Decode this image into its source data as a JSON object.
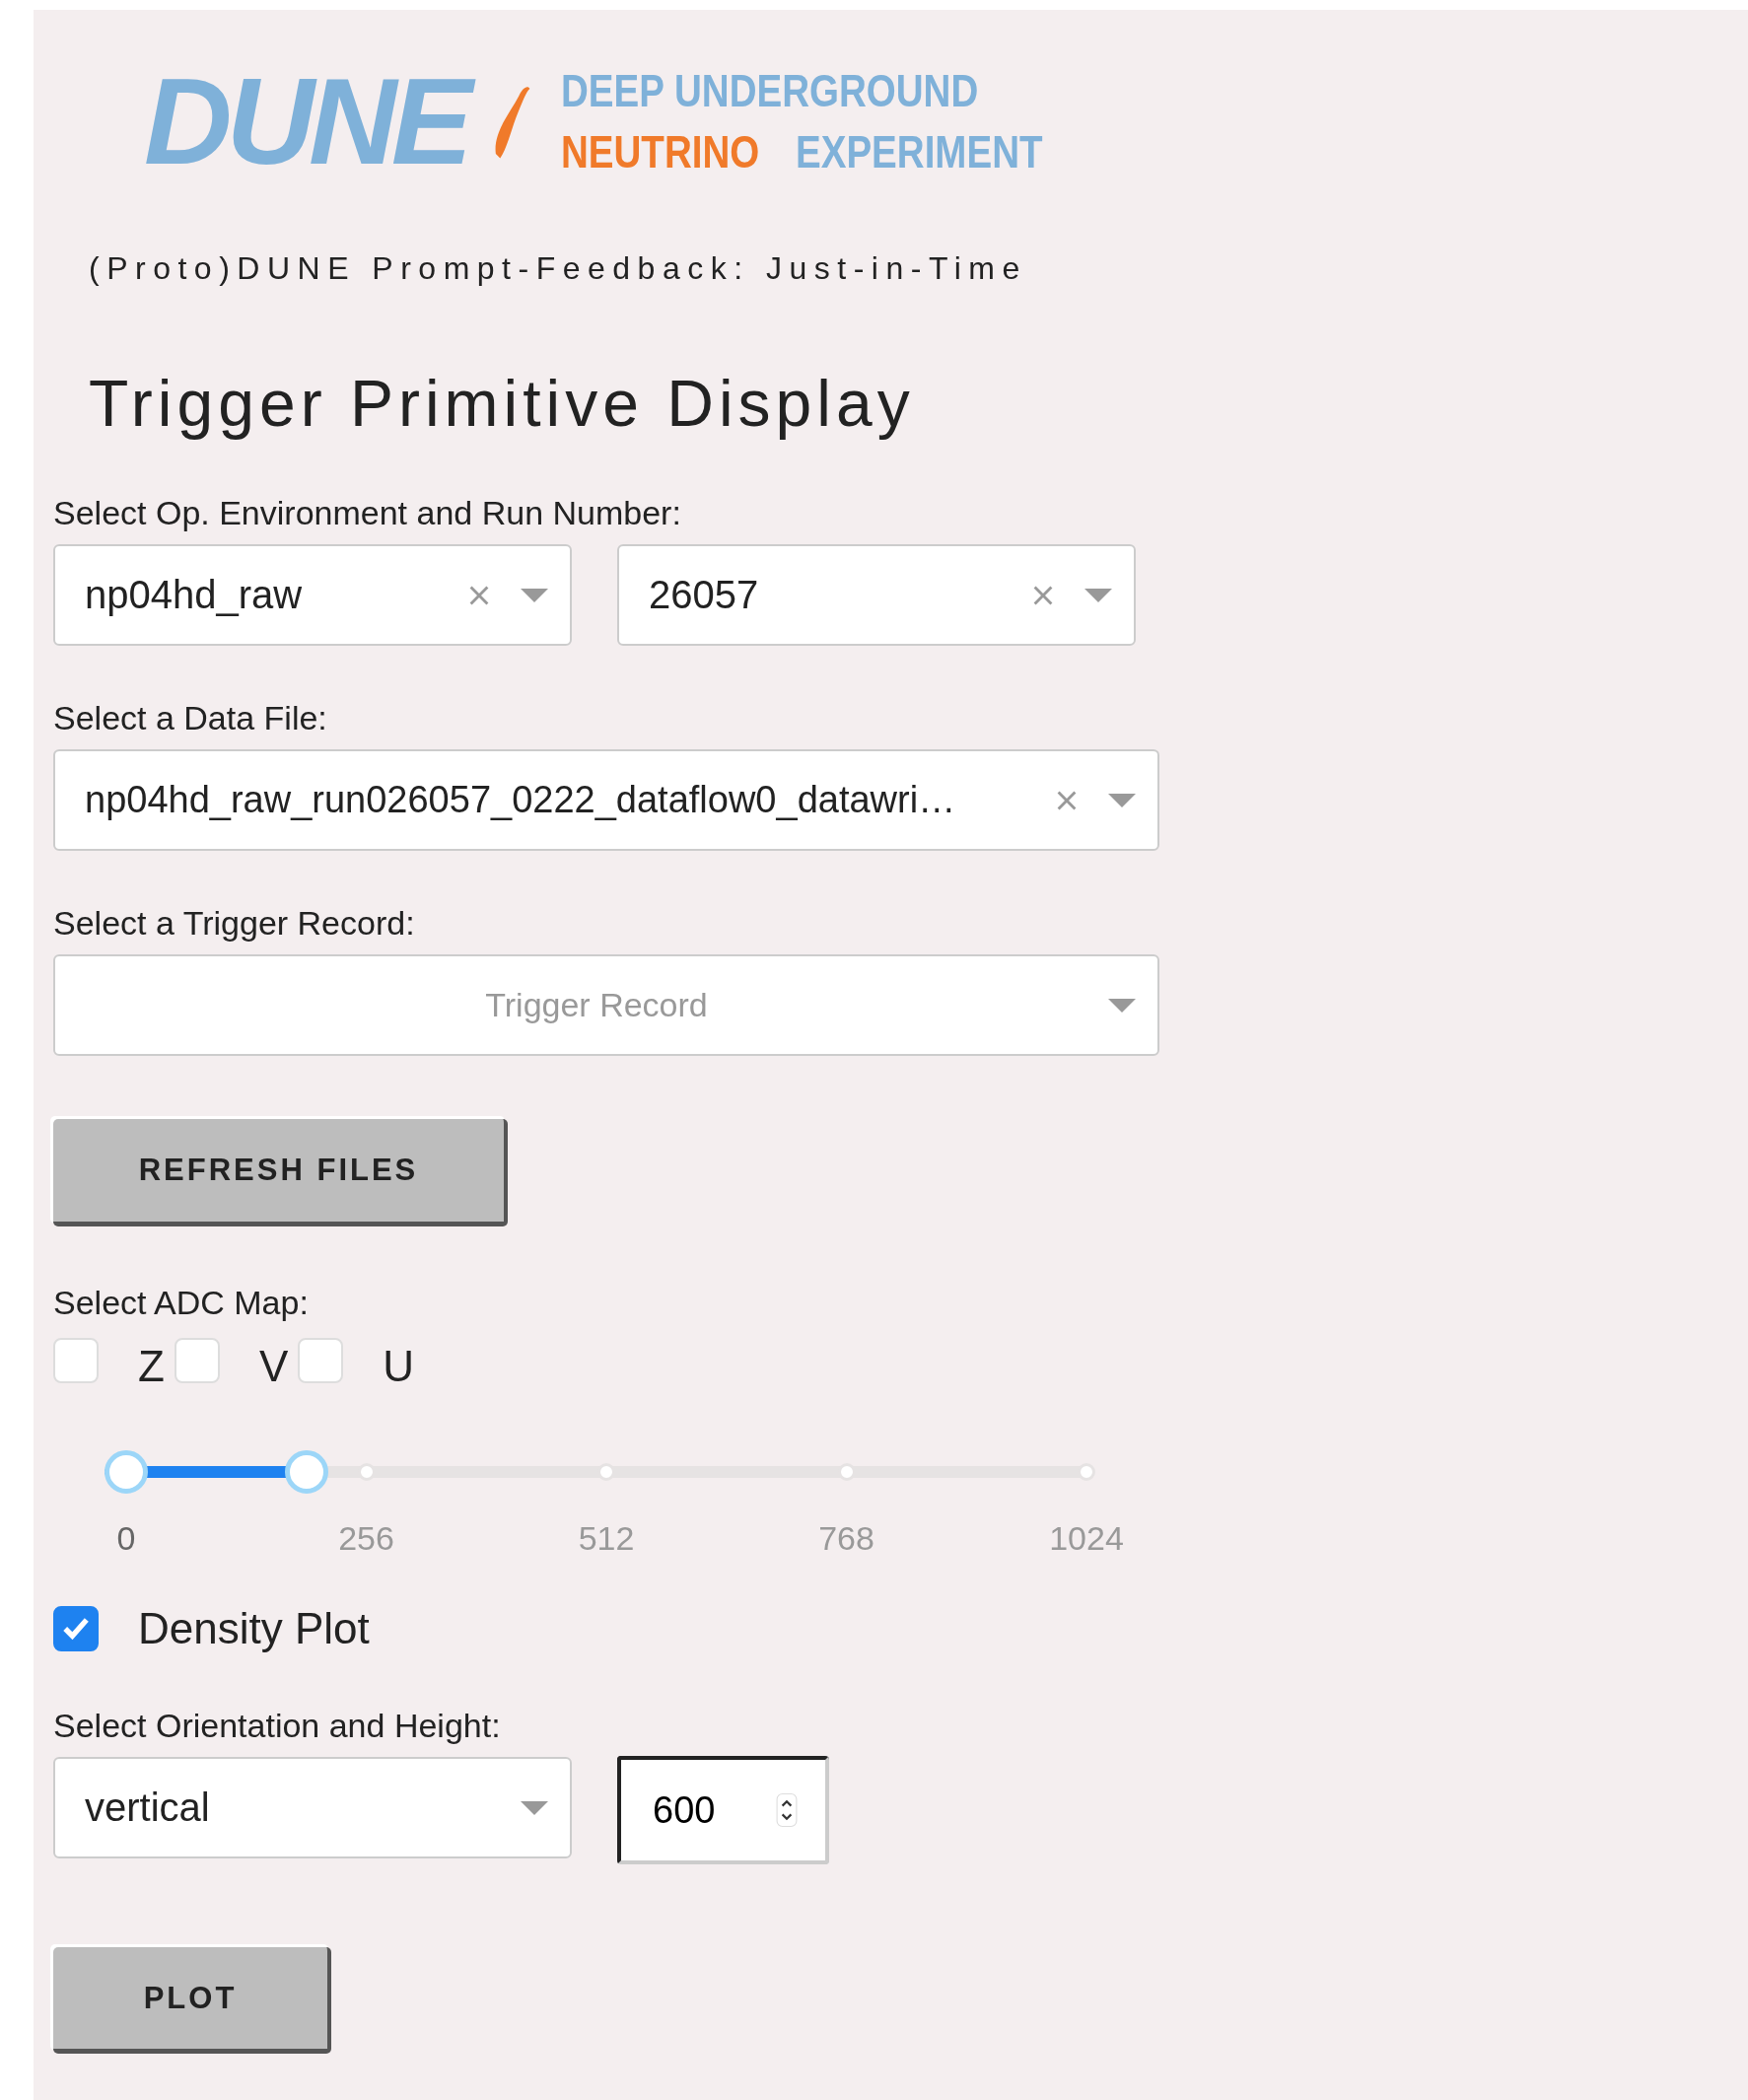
{
  "logo": {
    "wordmark": "DUNE",
    "lines": [
      [
        {
          "text": "DEEP UNDERGROUND",
          "accent": false
        }
      ],
      [
        {
          "text": "NEUTRINO",
          "accent": true
        },
        {
          "text": "EXPERIMENT",
          "accent": false
        }
      ]
    ]
  },
  "subtitle": "(Proto)DUNE Prompt-Feedback: Just-in-Time",
  "title": "Trigger Primitive Display",
  "run_selection": {
    "label": "Select Op. Environment and Run Number:",
    "dropdowns": [
      {
        "value": "np04hd_raw",
        "clear_button": true
      },
      {
        "value": "26057",
        "clear_button": true
      }
    ]
  },
  "data_file": {
    "label": "Select a Data File:",
    "dropdown": {
      "value": "np04hd_raw_run026057_0222_dataflow0_datawri…",
      "clear_button": true
    }
  },
  "trigger_record": {
    "label": "Select a Trigger Record:",
    "dropdown": {
      "placeholder": "Trigger Record"
    }
  },
  "refresh_button": "REFRESH FILES",
  "adc_map": {
    "label": "Select ADC Map:",
    "options": [
      {
        "label": "Z",
        "checked": false
      },
      {
        "label": "V",
        "checked": false
      },
      {
        "label": "U",
        "checked": false
      }
    ]
  },
  "adc_range": {
    "ticks": [
      "0",
      "256",
      "512",
      "768",
      "1024"
    ],
    "level": 0.188
  },
  "density_plot": {
    "label": "Density Plot",
    "checked": true
  },
  "orientation": {
    "label": "Select Orientation and Height:",
    "dropdown": {
      "value": "vertical"
    },
    "height": {
      "value": "600"
    }
  },
  "plot_button": "PLOT"
}
